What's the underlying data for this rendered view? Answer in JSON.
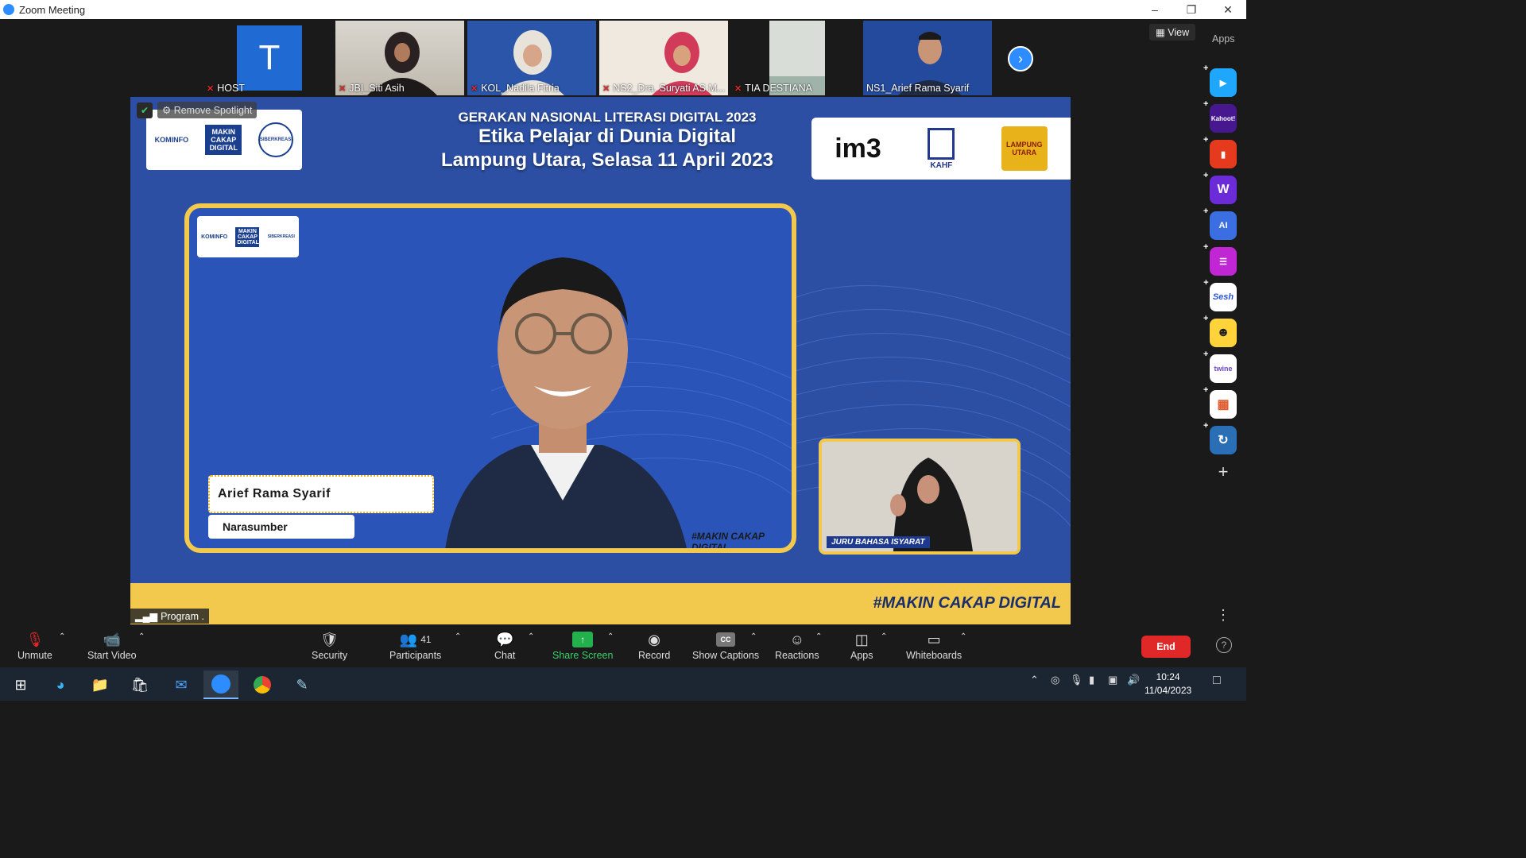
{
  "window": {
    "title": "Zoom Meeting",
    "minimize_icon": "minimize-icon",
    "restore_icon": "restore-icon",
    "close_icon": "close-icon"
  },
  "participants_strip": [
    {
      "name": "HOST",
      "kind": "avatar",
      "initial": "T"
    },
    {
      "name": "JBI_Siti Asih",
      "kind": "video"
    },
    {
      "name": "KOL_Nadila Fitria",
      "kind": "video"
    },
    {
      "name": "NS2_Dra. Suryati AS M...",
      "kind": "video"
    },
    {
      "name": "TIA DESTIANA",
      "kind": "video"
    },
    {
      "name": "NS1_Arief Rama Syarif",
      "kind": "video"
    }
  ],
  "top_right": {
    "view_label": "View",
    "apps_label": "Apps"
  },
  "main_video": {
    "remove_spotlight": "Remove Spotlight",
    "headline_line1": "GERAKAN NASIONAL LITERASI DIGITAL 2023",
    "headline_line2": "Etika Pelajar di Dunia Digital",
    "headline_line3": "Lampung Utara, Selasa 11 April 2023",
    "left_logos": [
      "KOMINFO",
      "MAKIN CAKAP DIGITAL",
      "SIBERKREASI"
    ],
    "right_logos": {
      "im3": "im3",
      "kahf": "KAHF",
      "regency": "LAMPUNG UTARA"
    },
    "speaker_name": "Arief Rama Syarif",
    "speaker_role": "Narasumber",
    "inner_tag": "#MAKIN CAKAP DIGITAL",
    "interpreter_label": "JURU BAHASA ISYARAT",
    "band_tag": "#MAKIN CAKAP DIGITAL",
    "program_badge": "Program ."
  },
  "side_apps": [
    {
      "name": "play",
      "color": "#1ea7fd"
    },
    {
      "name": "Kahoot!",
      "color": "#46178f"
    },
    {
      "name": "red-app",
      "color": "#e63a1e"
    },
    {
      "name": "W",
      "color": "#6c2bd9"
    },
    {
      "name": "AI",
      "color": "#3b6ee0"
    },
    {
      "name": "video-waves",
      "color": "#c026d3"
    },
    {
      "name": "Sesh",
      "color": "#ffffff"
    },
    {
      "name": "emoji",
      "color": "#ffd43b"
    },
    {
      "name": "twine",
      "color": "#ffffff"
    },
    {
      "name": "blocks",
      "color": "#ffffff"
    },
    {
      "name": "sync",
      "color": "#2a6fb5"
    }
  ],
  "toolbar": {
    "unmute": "Unmute",
    "start_video": "Start Video",
    "security": "Security",
    "participants": "Participants",
    "participants_count": "41",
    "chat": "Chat",
    "share_screen": "Share Screen",
    "record": "Record",
    "show_captions": "Show Captions",
    "cc": "CC",
    "reactions": "Reactions",
    "apps": "Apps",
    "whiteboards": "Whiteboards",
    "end": "End"
  },
  "taskbar": {
    "time": "10:24",
    "date": "11/04/2023"
  },
  "colors": {
    "accent_blue": "#2d8cff",
    "end_red": "#e02828",
    "share_green": "#22b14c",
    "frame_yellow": "#f2c94c",
    "slide_blue": "#2c4fa3"
  }
}
